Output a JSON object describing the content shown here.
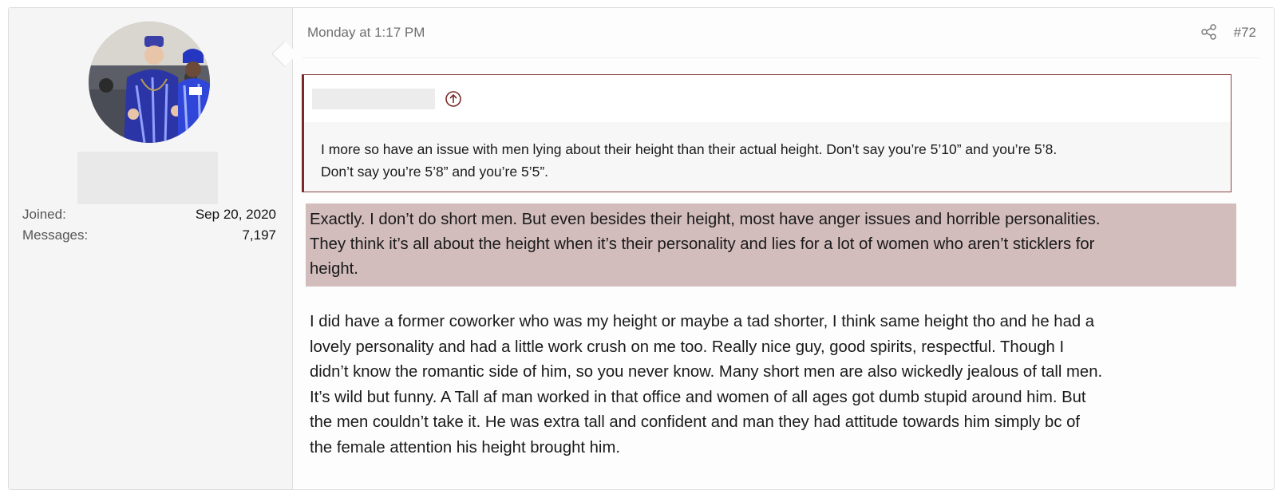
{
  "user": {
    "avatar": "avatar-photo-icon",
    "joined_label": "Joined:",
    "joined_value": "Sep 20, 2020",
    "messages_label": "Messages:",
    "messages_value": "7,197"
  },
  "post": {
    "time": "Monday at 1:17 PM",
    "share_icon": "share-icon",
    "number": "#72",
    "quote": {
      "up_icon": "arrow-up-circle-icon",
      "lines": [
        "I more so have an issue with men lying about their height than their actual height. Don’t say you’re 5’10” and you’re 5’8.",
        "Don’t say you’re 5’8” and you’re 5’5”."
      ]
    },
    "highlight_lines": [
      "Exactly. I don’t do short men. But even besides their height, most have anger issues and horrible personalities.",
      "They think it’s all about the height when it’s their personality and lies for a lot of women who aren’t sticklers for",
      "height."
    ],
    "body_lines": [
      "I did have a former coworker who was my height or maybe a tad shorter, I think same height tho and he had a",
      "lovely personality and had a little work crush on me too. Really nice guy, good spirits, respectful. Though I",
      "didn’t know the romantic side of him, so you never know. Many short men are also wickedly jealous of tall men.",
      "It’s wild but funny. A Tall af man worked in that office and women of all ages got dumb stupid around him. But",
      "the men couldn’t take it. He was extra tall and confident and man they had attitude towards him simply bc of",
      "the female attention his height brought him."
    ]
  },
  "colors": {
    "highlight": "#d2bcbc",
    "quote_border": "#7a2a2a",
    "sidebar_bg": "#f5f5f5"
  }
}
